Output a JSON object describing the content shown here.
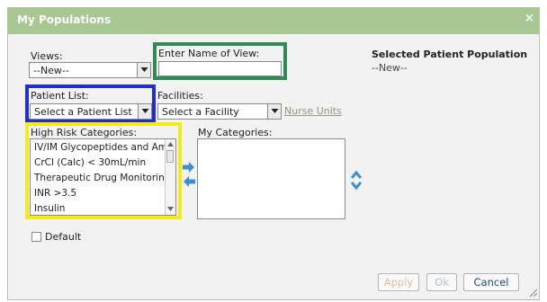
{
  "dialog": {
    "title": "My Populations",
    "close_symbol": "×"
  },
  "views": {
    "label": "Views:",
    "selected": "--New--"
  },
  "view_name": {
    "label": "Enter Name of View:",
    "value": ""
  },
  "selected_population": {
    "heading": "Selected Patient Population",
    "value": "--New--"
  },
  "patient_list": {
    "label": "Patient List:",
    "selected": "Select a Patient List"
  },
  "facilities": {
    "label": "Facilities:",
    "selected": "Select a Facility",
    "nurse_units_link": "Nurse Units"
  },
  "high_risk": {
    "label": "High Risk Categories:",
    "items": [
      "IV/IM Glycopeptides and Am",
      "CrCl (Calc) < 30mL/min",
      "Therapeutic Drug Monitorin",
      "INR >3.5",
      "Insulin"
    ]
  },
  "my_categories": {
    "label": "My Categories:",
    "items": []
  },
  "default_checkbox": {
    "label": "Default",
    "checked": false
  },
  "buttons": {
    "apply": "Apply",
    "ok": "Ok",
    "cancel": "Cancel"
  },
  "colors": {
    "title_bar": "#a8c792",
    "highlight_green": "#2e8b57",
    "highlight_blue": "#1f2fd0",
    "highlight_yellow": "#f3ea1a",
    "move_arrows": "#3c8fd6",
    "disabled_button_text": "#d9c79a"
  }
}
